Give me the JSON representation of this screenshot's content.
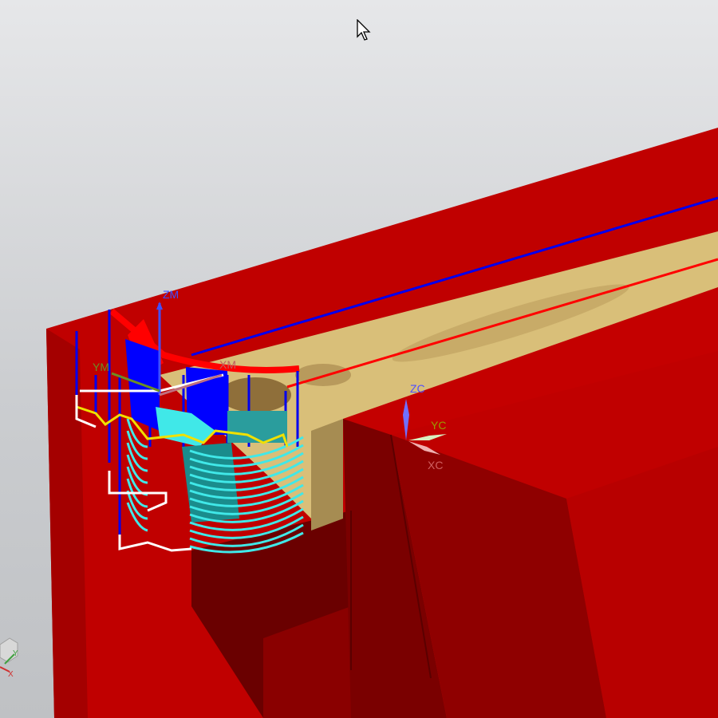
{
  "viewport": {
    "background_top": "#e6e7e9",
    "background_bottom": "#bfc1c4"
  },
  "part": {
    "body_color": "#c00000",
    "dark_face_color": "#6a0000",
    "shade_face_color": "#8f0000",
    "slot_floor_color": "#d9bf79",
    "slot_wall_color": "#a68c52"
  },
  "toolpath": {
    "engage_color": "#0000ee",
    "cut_color": "#ff0000",
    "rapid_color": "#ffffff",
    "step_color": "#f0e000",
    "tool_holder_color": "#0000ff",
    "tool_color": "#40e8e8"
  },
  "mcs": {
    "z_label": "ZM",
    "y_label": "YM",
    "x_label": "XM",
    "z_color": "#4050ff",
    "y_color": "#6b8e23",
    "x_color": "#c06060"
  },
  "wcs": {
    "z_label": "ZC",
    "y_label": "YC",
    "x_label": "XC",
    "z_color": "#5050ff",
    "y_color": "#9a9a00",
    "x_color": "#d06060"
  },
  "view_triad": {
    "y_label": "Y",
    "x_label": "X"
  },
  "cursor": {
    "icon": "arrow-cursor-icon"
  }
}
